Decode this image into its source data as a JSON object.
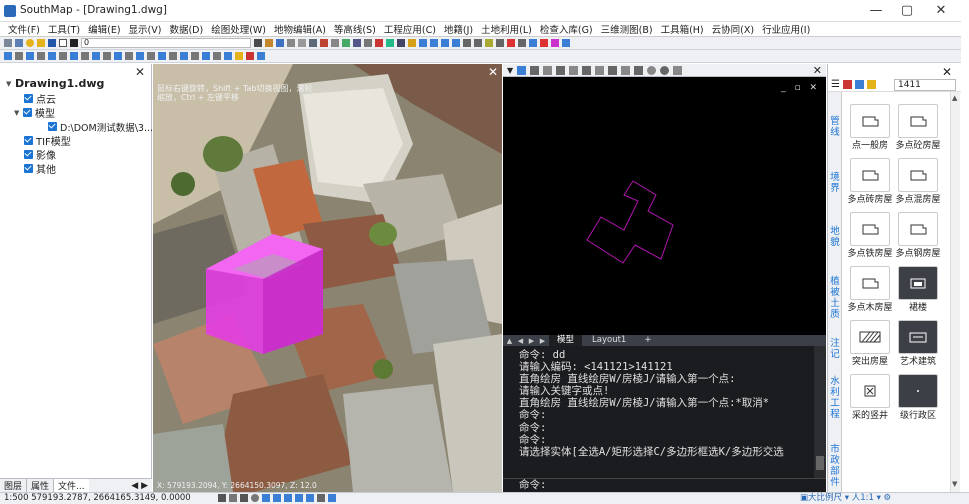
{
  "window": {
    "title": "SouthMap - [Drawing1.dwg]",
    "min": "—",
    "max": "▢",
    "close": "✕"
  },
  "menu": [
    "文件(F)",
    "工具(T)",
    "编辑(E)",
    "显示(V)",
    "数据(D)",
    "绘图处理(W)",
    "地物编辑(A)",
    "等高线(S)",
    "工程应用(C)",
    "地籍(J)",
    "土地利用(L)",
    "检查入库(G)",
    "三维测图(B)",
    "工具箱(H)",
    "云协同(X)",
    "行业应用(I)"
  ],
  "toolbar2": {
    "layer_value": "0"
  },
  "left_panel": {
    "close": "✕",
    "root": "Drawing1.dwg",
    "items": [
      {
        "label": "点云",
        "indent": 1
      },
      {
        "label": "模型",
        "indent": 1,
        "expanded": true
      },
      {
        "label": "D:\\DOM测试数据\\3...",
        "indent": 2
      },
      {
        "label": "TIF模型",
        "indent": 1
      },
      {
        "label": "影像",
        "indent": 1
      },
      {
        "label": "其他",
        "indent": 1
      }
    ],
    "tabs": [
      "图层",
      "属性",
      "文件..."
    ]
  },
  "image_view": {
    "close": "✕",
    "hint": "鼠标右键旋转，Shift + Tab切换视图，滚轮缩放，Ctrl + 左键平移",
    "coords": "X: 579193.2094, Y: 2664150.3097, Z: 12.0"
  },
  "cad_view": {
    "close": "✕",
    "win_controls": "_ ▫ ✕",
    "layout_tabs": [
      "模型",
      "Layout1",
      "+"
    ]
  },
  "command": {
    "lines": [
      "命令: dd",
      "请输入编码: <141121>141121",
      "直角绘房 直线绘房W/房棱J/请输入第一个点:",
      "请输入关键字或点!",
      "直角绘房 直线绘房W/房棱J/请输入第一个点:*取消*",
      "命令:",
      "命令:",
      "命令:",
      "请选择实体[全选A/矩形选择C/多边形框选K/多边形交选"
    ],
    "prompt": "命令:"
  },
  "right_panel": {
    "close": "✕",
    "search_value": "1411",
    "categories": [
      "管线",
      "境界",
      "地貌",
      "植被土质",
      "注记",
      "水利工程",
      "市政部件"
    ],
    "symbols": [
      {
        "label": "点一般房",
        "icon": "house-symbol-icon"
      },
      {
        "label": "多点砼房屋",
        "icon": "house-symbol-icon"
      },
      {
        "label": "多点砖房屋",
        "icon": "house-symbol-icon"
      },
      {
        "label": "多点混房屋",
        "icon": "house-symbol-icon"
      },
      {
        "label": "多点铁房屋",
        "icon": "house-symbol-icon"
      },
      {
        "label": "多点钢房屋",
        "icon": "house-symbol-icon"
      },
      {
        "label": "多点木房屋",
        "icon": "house-symbol-icon"
      },
      {
        "label": "裙楼",
        "icon": "podium-icon"
      },
      {
        "label": "突出房屋",
        "icon": "hatch-icon"
      },
      {
        "label": "艺术建筑",
        "icon": "art-building-icon"
      },
      {
        "label": "采的竖井",
        "icon": "shaft-icon"
      },
      {
        "label": "级行政区",
        "icon": "admin-region-icon"
      }
    ]
  },
  "status": {
    "text": "1:500  579193.2787,  2664165.3149,  0.0000",
    "right": "▣大比例尺 ▾ 人1:1 ▾ ⚙"
  }
}
